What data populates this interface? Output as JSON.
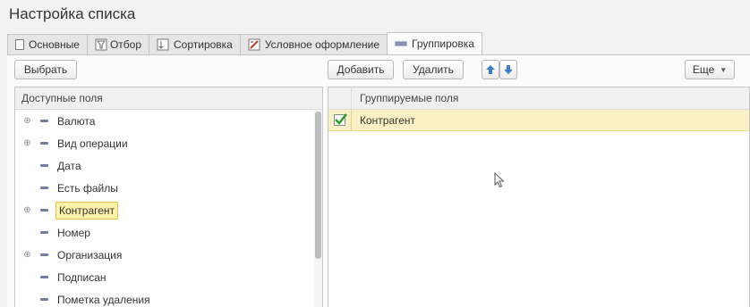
{
  "window": {
    "title": "Настройка списка"
  },
  "tabs": [
    {
      "label": "Основные",
      "icon": "document-icon"
    },
    {
      "label": "Отбор",
      "icon": "filter-icon"
    },
    {
      "label": "Сортировка",
      "icon": "sort-icon"
    },
    {
      "label": "Условное оформление",
      "icon": "conditional-format-icon"
    },
    {
      "label": "Группировка",
      "icon": "grouping-icon",
      "active": true
    }
  ],
  "left_panel": {
    "select_label": "Выбрать",
    "header": "Доступные поля",
    "items": [
      {
        "label": "Валюта",
        "expandable": true
      },
      {
        "label": "Вид операции",
        "expandable": true
      },
      {
        "label": "Дата",
        "expandable": false
      },
      {
        "label": "Есть файлы",
        "expandable": false
      },
      {
        "label": "Контрагент",
        "expandable": true,
        "selected": true
      },
      {
        "label": "Номер",
        "expandable": false
      },
      {
        "label": "Организация",
        "expandable": true
      },
      {
        "label": "Подписан",
        "expandable": false
      },
      {
        "label": "Пометка удаления",
        "expandable": false
      }
    ]
  },
  "right_panel": {
    "add_label": "Добавить",
    "delete_label": "Удалить",
    "more_label": "Еще",
    "header": "Группируемые поля",
    "rows": [
      {
        "label": "Контрагент",
        "checked": true
      }
    ]
  },
  "colors": {
    "selection_fill": "#fdf2a9",
    "selection_border": "#e8c547",
    "row_highlight": "#faf0c4",
    "arrow_blue": "#3d7fc7",
    "check_green": "#2e9a2e"
  }
}
